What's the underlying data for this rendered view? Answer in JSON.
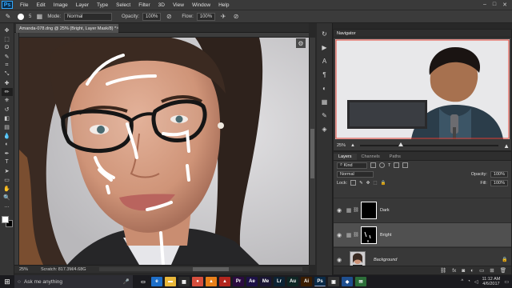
{
  "menubar": {
    "logo": "Ps",
    "items": [
      "File",
      "Edit",
      "Image",
      "Layer",
      "Type",
      "Select",
      "Filter",
      "3D",
      "View",
      "Window",
      "Help"
    ],
    "window_controls": [
      "–",
      "□",
      "✕"
    ]
  },
  "options": {
    "brush_size": "5",
    "mode_label": "Mode:",
    "mode_value": "Normal",
    "opacity_label": "Opacity:",
    "opacity_value": "100%",
    "flow_label": "Flow:",
    "flow_value": "100%"
  },
  "document": {
    "tab_title": "Amanda-078.dng @ 25% (Bright, Layer Mask/8) *",
    "tab_close": "×",
    "zoom": "25%",
    "doc_info": "Scratch: 817.3M/4.68G"
  },
  "tools": [
    {
      "name": "move-tool",
      "glyph": "✥"
    },
    {
      "name": "marquee-tool",
      "glyph": "⬚"
    },
    {
      "name": "lasso-tool",
      "glyph": "ʘ"
    },
    {
      "name": "quick-select-tool",
      "glyph": "✎"
    },
    {
      "name": "crop-tool",
      "glyph": "⌗"
    },
    {
      "name": "eyedropper-tool",
      "glyph": "⤡"
    },
    {
      "name": "healing-tool",
      "glyph": "✚"
    },
    {
      "name": "brush-tool",
      "glyph": "✏"
    },
    {
      "name": "clone-stamp-tool",
      "glyph": "⎈"
    },
    {
      "name": "history-brush-tool",
      "glyph": "↺"
    },
    {
      "name": "eraser-tool",
      "glyph": "◧"
    },
    {
      "name": "gradient-tool",
      "glyph": "▤"
    },
    {
      "name": "blur-tool",
      "glyph": "💧"
    },
    {
      "name": "dodge-tool",
      "glyph": "◐"
    },
    {
      "name": "pen-tool",
      "glyph": "✒"
    },
    {
      "name": "type-tool",
      "glyph": "T"
    },
    {
      "name": "path-select-tool",
      "glyph": "➤"
    },
    {
      "name": "shape-tool",
      "glyph": "▭"
    },
    {
      "name": "hand-tool",
      "glyph": "✋"
    },
    {
      "name": "zoom-tool",
      "glyph": "🔍"
    },
    {
      "name": "more-tools",
      "glyph": "…"
    }
  ],
  "panel_icons": [
    {
      "name": "history-panel-icon",
      "glyph": "↻"
    },
    {
      "name": "actions-panel-icon",
      "glyph": "▶"
    },
    {
      "name": "character-panel-icon",
      "glyph": "A"
    },
    {
      "name": "paragraph-panel-icon",
      "glyph": "¶"
    },
    {
      "name": "adjustments-panel-icon",
      "glyph": "◐"
    },
    {
      "name": "libraries-panel-icon",
      "glyph": "▦"
    },
    {
      "name": "brush-panel-icon",
      "glyph": "✎"
    },
    {
      "name": "3d-panel-icon",
      "glyph": "◈"
    }
  ],
  "navigator": {
    "title": "Navigator",
    "zoom": "25%"
  },
  "layers_panel": {
    "tabs": [
      "Layers",
      "Channels",
      "Paths"
    ],
    "kind_label": "Kind",
    "blend_mode": "Normal",
    "opacity_label": "Opacity:",
    "opacity_value": "100%",
    "lock_label": "Lock:",
    "fill_label": "Fill:",
    "fill_value": "100%",
    "layers": [
      {
        "name": "Dark",
        "selected": false,
        "mask_white_marks": false
      },
      {
        "name": "Bright",
        "selected": true,
        "mask_white_marks": true
      },
      {
        "name": "Background",
        "selected": false,
        "locked": true
      }
    ],
    "footer_icons": [
      "link-icon",
      "fx-icon",
      "mask-icon",
      "adjustment-icon",
      "group-icon",
      "new-layer-icon",
      "trash-icon"
    ]
  },
  "taskbar": {
    "search_placeholder": "Ask me anything",
    "apps": [
      {
        "name": "task-view",
        "label": "▭",
        "color": "#1b1b1f"
      },
      {
        "name": "edge",
        "label": "e",
        "color": "#1e6fc9"
      },
      {
        "name": "explorer",
        "label": "▬",
        "color": "#e8b73a"
      },
      {
        "name": "store",
        "label": "▦",
        "color": "#2b2b2b"
      },
      {
        "name": "chrome",
        "label": "●",
        "color": "#d64f3e"
      },
      {
        "name": "vlc",
        "label": "▲",
        "color": "#e8801a"
      },
      {
        "name": "filezilla",
        "label": "▲",
        "color": "#b3261e"
      },
      {
        "name": "premiere",
        "label": "Pr",
        "color": "#2a0b3f"
      },
      {
        "name": "after-effects",
        "label": "Ae",
        "color": "#1d1147"
      },
      {
        "name": "media-encoder",
        "label": "Me",
        "color": "#1a1534"
      },
      {
        "name": "lightroom",
        "label": "Lr",
        "color": "#0c2233"
      },
      {
        "name": "audition",
        "label": "Au",
        "color": "#0e2624"
      },
      {
        "name": "illustrator",
        "label": "Ai",
        "color": "#3a1d00"
      },
      {
        "name": "photoshop",
        "label": "Ps",
        "color": "#0a2a47"
      },
      {
        "name": "app-dark",
        "label": "▣",
        "color": "#333"
      },
      {
        "name": "app-blue",
        "label": "◆",
        "color": "#1f4f8f"
      },
      {
        "name": "app-green",
        "label": "✉",
        "color": "#2c6e39"
      }
    ],
    "time": "11:12 AM",
    "date": "4/6/2017"
  }
}
